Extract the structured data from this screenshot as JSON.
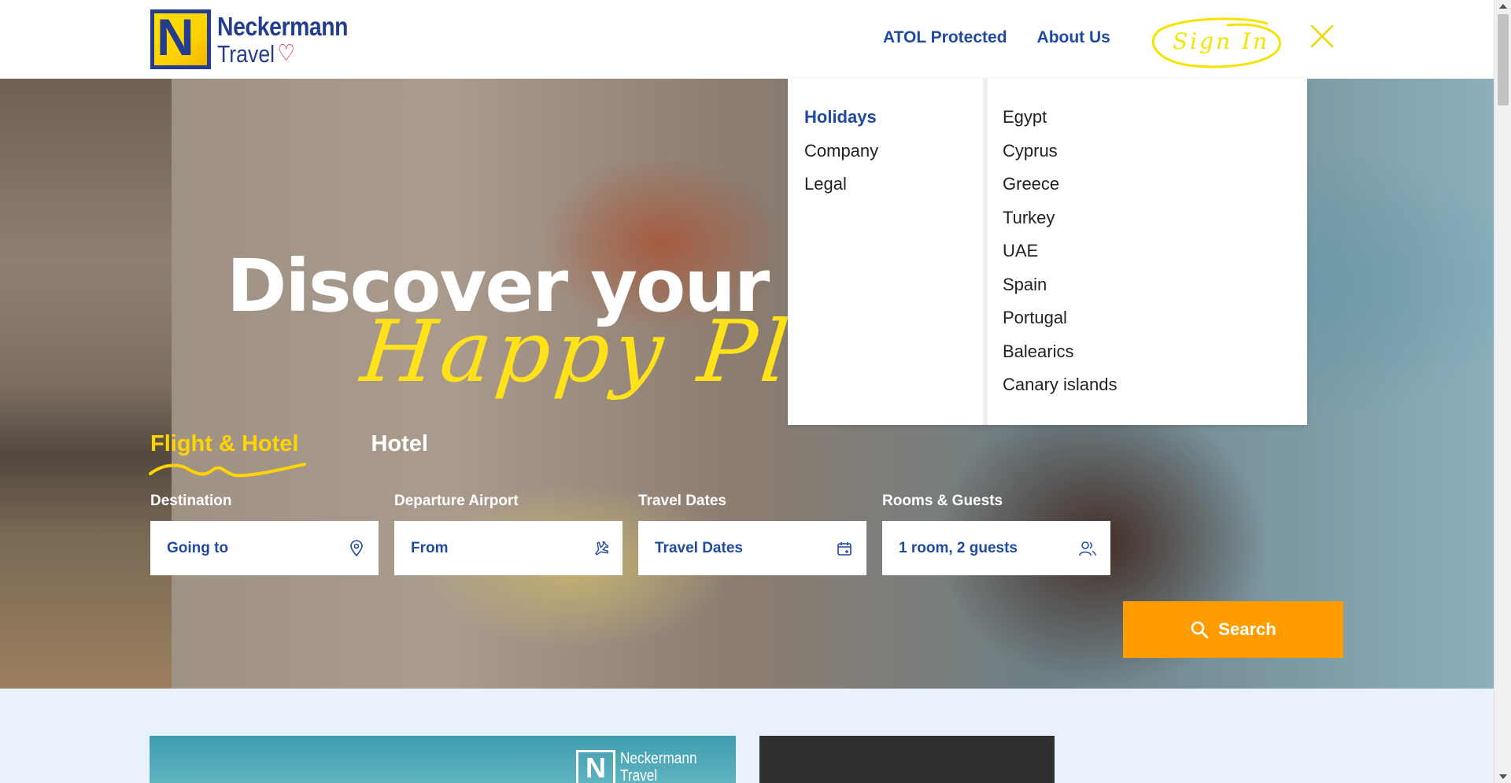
{
  "header": {
    "logo": {
      "line1": "Neckermann",
      "line2": "Travel",
      "mark": "N"
    },
    "nav": [
      "ATOL Protected",
      "About Us"
    ],
    "signin_label": "Sign In"
  },
  "hero": {
    "headline": "Discover your",
    "headline_script": "Happy Plac",
    "tabs": [
      {
        "label": "Flight & Hotel",
        "active": true
      },
      {
        "label": "Hotel",
        "active": false
      }
    ],
    "fields": [
      {
        "label": "Destination",
        "value": "Going to",
        "icon": "location-pin-icon"
      },
      {
        "label": "Departure Airport",
        "value": "From",
        "icon": "airplane-icon"
      },
      {
        "label": "Travel Dates",
        "value": "Travel Dates",
        "icon": "calendar-icon"
      },
      {
        "label": "Rooms & Guests",
        "value": "1 room, 2 guests",
        "icon": "guests-icon"
      }
    ],
    "search_label": "Search"
  },
  "menu": {
    "left": [
      "Holidays",
      "Company",
      "Legal"
    ],
    "right": [
      "Egypt",
      "Cyprus",
      "Greece",
      "Turkey",
      "UAE",
      "Spain",
      "Portugal",
      "Balearics",
      "Canary islands"
    ]
  },
  "below": {
    "card_logo": {
      "line1": "Neckermann",
      "line2": "Travel",
      "mark": "N"
    }
  },
  "colors": {
    "brand_blue": "#1f4aa0",
    "brand_yellow": "#ffd400",
    "search_orange": "#ff9d00"
  }
}
